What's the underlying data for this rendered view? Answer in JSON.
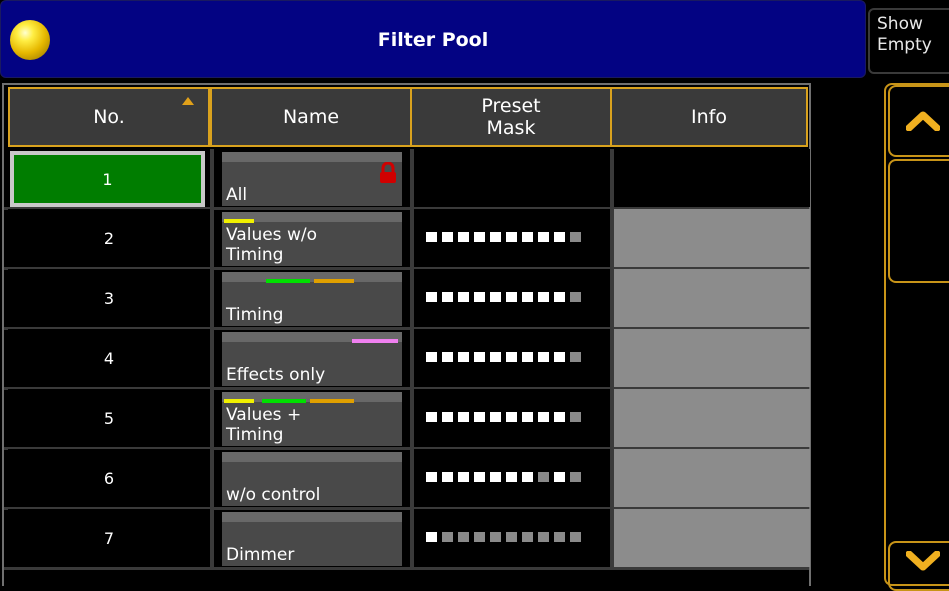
{
  "window": {
    "title": "Filter Pool"
  },
  "show_empty": {
    "line1": "Show",
    "line2": "Empty"
  },
  "columns": {
    "no": "No.",
    "name": "Name",
    "preset_mask": "Preset\nMask",
    "info": "Info"
  },
  "colors": {
    "accent": "#d9a21e",
    "selected": "#007d00",
    "titlebar": "#030383",
    "lock": "#d00000"
  },
  "rows": [
    {
      "no": "1",
      "name": "All",
      "locked": true,
      "selected": true,
      "mask": [],
      "info_visible": false,
      "bars": []
    },
    {
      "no": "2",
      "name": "Values w/o\nTiming",
      "locked": false,
      "selected": false,
      "mask": [
        1,
        1,
        1,
        1,
        1,
        1,
        1,
        1,
        1,
        0
      ],
      "info_visible": true,
      "bars": [
        {
          "color": "#f0f000"
        }
      ]
    },
    {
      "no": "3",
      "name": "Timing",
      "locked": false,
      "selected": false,
      "mask": [
        1,
        1,
        1,
        1,
        1,
        1,
        1,
        1,
        1,
        0
      ],
      "info_visible": true,
      "bars": [
        {
          "color": "#00e000"
        },
        {
          "color": "#e0a000"
        }
      ]
    },
    {
      "no": "4",
      "name": "Effects only",
      "locked": false,
      "selected": false,
      "mask": [
        1,
        1,
        1,
        1,
        1,
        1,
        1,
        1,
        1,
        0
      ],
      "info_visible": true,
      "bars": [
        {
          "color": "#f080f0"
        }
      ]
    },
    {
      "no": "5",
      "name": "Values +\nTiming",
      "locked": false,
      "selected": false,
      "mask": [
        1,
        1,
        1,
        1,
        1,
        1,
        1,
        1,
        1,
        0
      ],
      "info_visible": true,
      "bars": [
        {
          "color": "#f0f000"
        },
        {
          "color": "#00e000"
        },
        {
          "color": "#e0a000"
        }
      ]
    },
    {
      "no": "6",
      "name": "w/o control",
      "locked": false,
      "selected": false,
      "mask": [
        1,
        1,
        1,
        1,
        1,
        1,
        1,
        0,
        1,
        0
      ],
      "info_visible": true,
      "bars": []
    },
    {
      "no": "7",
      "name": "Dimmer",
      "locked": false,
      "selected": false,
      "mask": [
        1,
        0,
        0,
        0,
        0,
        0,
        0,
        0,
        0,
        0
      ],
      "info_visible": true,
      "bars": []
    }
  ],
  "scrollbar": {
    "up_icon": "chevron-up-icon",
    "down_icon": "chevron-down-icon"
  }
}
